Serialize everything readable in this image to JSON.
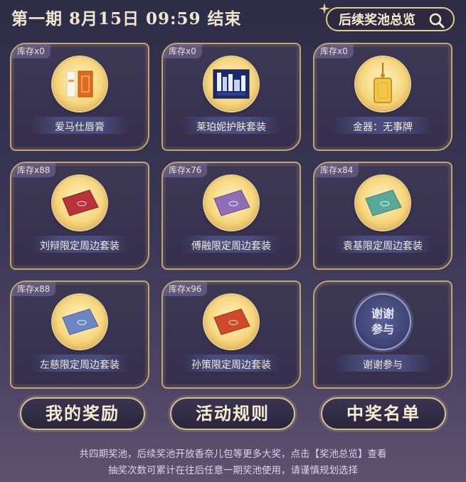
{
  "header": {
    "title": "第一期  8月15日  09:59  结束",
    "overview_button": "后续奖池总览"
  },
  "prizes": [
    {
      "stock": "库存x0",
      "name": "爱马仕唇膏",
      "icon": "lipstick-icon"
    },
    {
      "stock": "库存x0",
      "name": "莱珀妮护肤套装",
      "icon": "skincare-set-icon"
    },
    {
      "stock": "库存x0",
      "name": "金器：无事牌",
      "icon": "gold-pendant-icon"
    },
    {
      "stock": "库存x88",
      "name": "刘辩限定周边套装",
      "icon": "red-envelope-icon",
      "color": "#b8333b"
    },
    {
      "stock": "库存x76",
      "name": "傅融限定周边套装",
      "icon": "purple-envelope-icon",
      "color": "#8e6fb5"
    },
    {
      "stock": "库存x84",
      "name": "袁基限定周边套装",
      "icon": "teal-envelope-icon",
      "color": "#5aa89a"
    },
    {
      "stock": "库存x88",
      "name": "左慈限定周边套装",
      "icon": "blue-envelope-icon",
      "color": "#6b86c2"
    },
    {
      "stock": "库存x96",
      "name": "孙策限定周边套装",
      "icon": "orange-envelope-icon",
      "color": "#cf4a2a"
    },
    {
      "stock": "",
      "name": "谢谢参与",
      "icon": "thanks-medal-icon",
      "medal_text": "谢谢参与"
    }
  ],
  "buttons": {
    "my_rewards": "我的奖励",
    "rules": "活动规则",
    "winners": "中奖名单"
  },
  "notice": {
    "line1": "共四期奖池，后续奖池开放香奈儿包等更多大奖，点击【奖池总览】查看",
    "line2": "抽奖次数可累计在往后任意一期奖池使用，请谨慎规划选择"
  }
}
